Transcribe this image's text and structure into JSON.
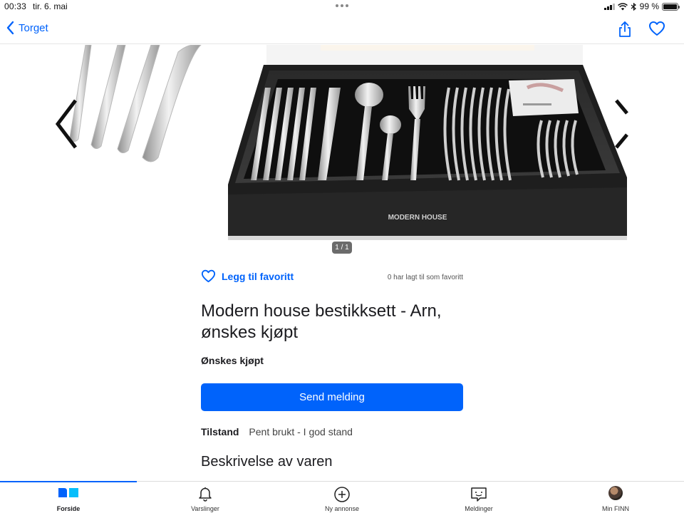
{
  "status_bar": {
    "time": "00:33",
    "date": "tir. 6. mai",
    "battery": "99 %",
    "battery_level": 0.99
  },
  "nav": {
    "back_label": "Torget"
  },
  "gallery": {
    "counter": "1 / 1",
    "box_brand": "MODERN HOUSE"
  },
  "favorite": {
    "button_label": "Legg til favoritt",
    "count_text": "0 har lagt til som favoritt"
  },
  "listing": {
    "title": "Modern house bestikksett - Arn, ønskes kjøpt",
    "type": "Ønskes kjøpt",
    "send_button": "Send melding",
    "condition_label": "Tilstand",
    "condition_value": "Pent brukt - I god stand",
    "description_heading": "Beskrivelse av varen"
  },
  "tabs": [
    {
      "label": "Forside",
      "icon": "home-icon",
      "active": true
    },
    {
      "label": "Varslinger",
      "icon": "bell-icon",
      "active": false
    },
    {
      "label": "Ny annonse",
      "icon": "plus-circle-icon",
      "active": false
    },
    {
      "label": "Meldinger",
      "icon": "chat-icon",
      "active": false
    },
    {
      "label": "Min FINN",
      "icon": "avatar",
      "active": false
    }
  ],
  "colors": {
    "accent": "#0063fb",
    "text": "#1b1b1f"
  }
}
